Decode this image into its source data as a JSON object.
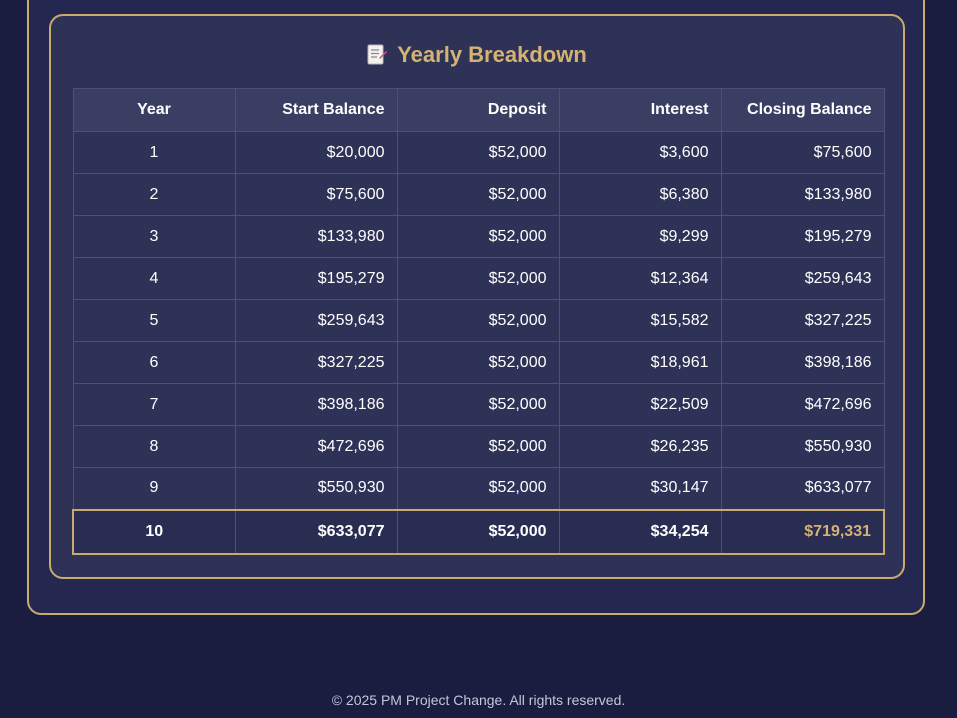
{
  "breakdown": {
    "title": "Yearly Breakdown",
    "title_icon": "memo-icon",
    "columns": [
      "Year",
      "Start Balance",
      "Deposit",
      "Interest",
      "Closing Balance"
    ],
    "rows": [
      [
        "1",
        "$20,000",
        "$52,000",
        "$3,600",
        "$75,600"
      ],
      [
        "2",
        "$75,600",
        "$52,000",
        "$6,380",
        "$133,980"
      ],
      [
        "3",
        "$133,980",
        "$52,000",
        "$9,299",
        "$195,279"
      ],
      [
        "4",
        "$195,279",
        "$52,000",
        "$12,364",
        "$259,643"
      ],
      [
        "5",
        "$259,643",
        "$52,000",
        "$15,582",
        "$327,225"
      ],
      [
        "6",
        "$327,225",
        "$52,000",
        "$18,961",
        "$398,186"
      ],
      [
        "7",
        "$398,186",
        "$52,000",
        "$22,509",
        "$472,696"
      ],
      [
        "8",
        "$472,696",
        "$52,000",
        "$26,235",
        "$550,930"
      ],
      [
        "9",
        "$550,930",
        "$52,000",
        "$30,147",
        "$633,077"
      ],
      [
        "10",
        "$633,077",
        "$52,000",
        "$34,254",
        "$719,331"
      ]
    ],
    "highlight_color": "#d4b273"
  },
  "footer": {
    "text": "© 2025 PM Project Change. All rights reserved."
  }
}
